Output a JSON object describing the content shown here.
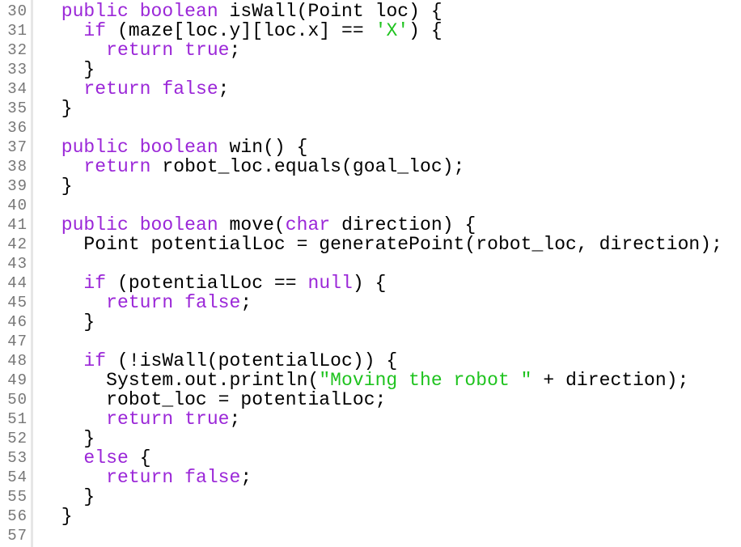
{
  "editor": {
    "language": "java",
    "colors": {
      "keyword": "#9b27d8",
      "string": "#1fc31f",
      "plain": "#000000",
      "line_number": "#777777",
      "gutter_border": "#e6e6e6"
    },
    "lines": [
      {
        "number": "30",
        "tokens": [
          {
            "t": "  "
          },
          {
            "t": "public",
            "k": "kw"
          },
          {
            "t": " "
          },
          {
            "t": "boolean",
            "k": "kw"
          },
          {
            "t": " isWall(Point loc) {"
          }
        ]
      },
      {
        "number": "31",
        "tokens": [
          {
            "t": "    "
          },
          {
            "t": "if",
            "k": "kw"
          },
          {
            "t": " (maze[loc.y][loc.x] == "
          },
          {
            "t": "'X'",
            "k": "str"
          },
          {
            "t": ") {"
          }
        ]
      },
      {
        "number": "32",
        "tokens": [
          {
            "t": "      "
          },
          {
            "t": "return",
            "k": "kw"
          },
          {
            "t": " "
          },
          {
            "t": "true",
            "k": "kw"
          },
          {
            "t": ";"
          }
        ]
      },
      {
        "number": "33",
        "tokens": [
          {
            "t": "    }"
          }
        ]
      },
      {
        "number": "34",
        "tokens": [
          {
            "t": "    "
          },
          {
            "t": "return",
            "k": "kw"
          },
          {
            "t": " "
          },
          {
            "t": "false",
            "k": "kw"
          },
          {
            "t": ";"
          }
        ]
      },
      {
        "number": "35",
        "tokens": [
          {
            "t": "  }"
          }
        ]
      },
      {
        "number": "36",
        "tokens": []
      },
      {
        "number": "37",
        "tokens": [
          {
            "t": "  "
          },
          {
            "t": "public",
            "k": "kw"
          },
          {
            "t": " "
          },
          {
            "t": "boolean",
            "k": "kw"
          },
          {
            "t": " win() {"
          }
        ]
      },
      {
        "number": "38",
        "tokens": [
          {
            "t": "    "
          },
          {
            "t": "return",
            "k": "kw"
          },
          {
            "t": " robot_loc.equals(goal_loc);"
          }
        ]
      },
      {
        "number": "39",
        "tokens": [
          {
            "t": "  }"
          }
        ]
      },
      {
        "number": "40",
        "tokens": []
      },
      {
        "number": "41",
        "tokens": [
          {
            "t": "  "
          },
          {
            "t": "public",
            "k": "kw"
          },
          {
            "t": " "
          },
          {
            "t": "boolean",
            "k": "kw"
          },
          {
            "t": " move("
          },
          {
            "t": "char",
            "k": "kw"
          },
          {
            "t": " direction) {"
          }
        ]
      },
      {
        "number": "42",
        "tokens": [
          {
            "t": "    Point potentialLoc = generatePoint(robot_loc, direction);"
          }
        ]
      },
      {
        "number": "43",
        "tokens": []
      },
      {
        "number": "44",
        "tokens": [
          {
            "t": "    "
          },
          {
            "t": "if",
            "k": "kw"
          },
          {
            "t": " (potentialLoc == "
          },
          {
            "t": "null",
            "k": "kw"
          },
          {
            "t": ") {"
          }
        ]
      },
      {
        "number": "45",
        "tokens": [
          {
            "t": "      "
          },
          {
            "t": "return",
            "k": "kw"
          },
          {
            "t": " "
          },
          {
            "t": "false",
            "k": "kw"
          },
          {
            "t": ";"
          }
        ]
      },
      {
        "number": "46",
        "tokens": [
          {
            "t": "    }"
          }
        ]
      },
      {
        "number": "47",
        "tokens": []
      },
      {
        "number": "48",
        "tokens": [
          {
            "t": "    "
          },
          {
            "t": "if",
            "k": "kw"
          },
          {
            "t": " (!isWall(potentialLoc)) {"
          }
        ]
      },
      {
        "number": "49",
        "tokens": [
          {
            "t": "      System.out.println("
          },
          {
            "t": "\"Moving the robot \"",
            "k": "str"
          },
          {
            "t": " + direction);"
          }
        ]
      },
      {
        "number": "50",
        "tokens": [
          {
            "t": "      robot_loc = potentialLoc;"
          }
        ]
      },
      {
        "number": "51",
        "tokens": [
          {
            "t": "      "
          },
          {
            "t": "return",
            "k": "kw"
          },
          {
            "t": " "
          },
          {
            "t": "true",
            "k": "kw"
          },
          {
            "t": ";"
          }
        ]
      },
      {
        "number": "52",
        "tokens": [
          {
            "t": "    }"
          }
        ]
      },
      {
        "number": "53",
        "tokens": [
          {
            "t": "    "
          },
          {
            "t": "else",
            "k": "kw"
          },
          {
            "t": " {"
          }
        ]
      },
      {
        "number": "54",
        "tokens": [
          {
            "t": "      "
          },
          {
            "t": "return",
            "k": "kw"
          },
          {
            "t": " "
          },
          {
            "t": "false",
            "k": "kw"
          },
          {
            "t": ";"
          }
        ]
      },
      {
        "number": "55",
        "tokens": [
          {
            "t": "    }"
          }
        ]
      },
      {
        "number": "56",
        "tokens": [
          {
            "t": "  }"
          }
        ]
      },
      {
        "number": "57",
        "tokens": []
      }
    ]
  }
}
